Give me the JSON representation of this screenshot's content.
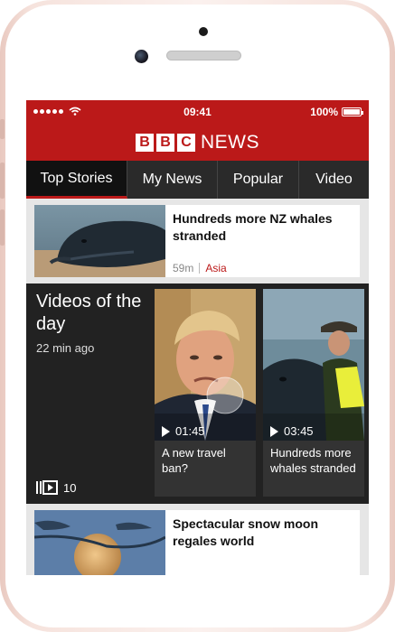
{
  "status_bar": {
    "time": "09:41",
    "battery": "100%"
  },
  "brand": {
    "letters": [
      "B",
      "B",
      "C"
    ],
    "word": "NEWS",
    "color": "#bb1919"
  },
  "tabs": [
    {
      "label": "Top Stories",
      "active": true
    },
    {
      "label": "My News"
    },
    {
      "label": "Popular"
    },
    {
      "label": "Video"
    }
  ],
  "stories": [
    {
      "headline": "Hundreds more NZ whales stranded",
      "age": "59m",
      "topic": "Asia",
      "image": "whale-photo"
    },
    {
      "headline": "Spectacular snow moon regales world",
      "image": "moon-photo"
    }
  ],
  "videos": {
    "title": "Videos of the day",
    "age": "22 min ago",
    "count": "10",
    "items": [
      {
        "duration": "01:45",
        "caption": "A new travel ban?",
        "image": "trump-photo"
      },
      {
        "duration": "03:45",
        "caption": "Hundreds more whales stranded",
        "image": "whale-rescue-photo"
      }
    ]
  }
}
